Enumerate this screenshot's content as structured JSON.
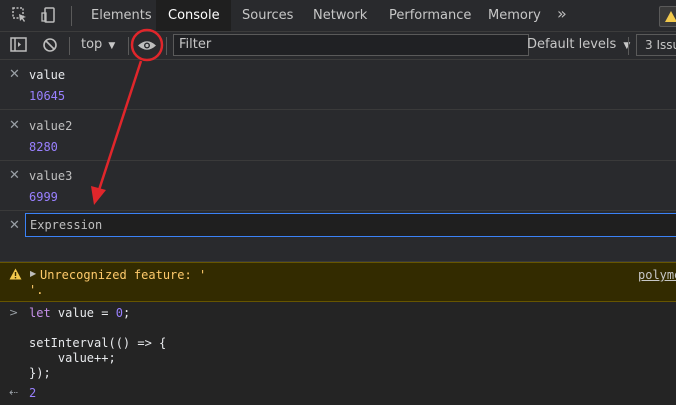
{
  "tabs": [
    {
      "label": "Elements"
    },
    {
      "label": "Console"
    },
    {
      "label": "Sources"
    },
    {
      "label": "Network"
    },
    {
      "label": "Performance"
    },
    {
      "label": "Memory"
    }
  ],
  "more_tabs": "»",
  "toolbar": {
    "context": "top",
    "filter_placeholder": "Filter",
    "levels": "Default levels",
    "issues": "3 Issu"
  },
  "live_expressions": [
    {
      "name": "value",
      "value": "10645"
    },
    {
      "name": "value2",
      "value": "8280"
    },
    {
      "name": "value3",
      "value": "6999"
    }
  ],
  "expression_placeholder": "Expression",
  "warning": {
    "line1": "Unrecognized feature: '",
    "line2": "'.",
    "source": "polyme"
  },
  "code": {
    "line1_kw": "let",
    "line1_rest": " value = ",
    "line1_num": "0",
    "line1_end": ";",
    "line2": "setInterval(() => {",
    "line3": "    value++;",
    "line4": "});",
    "result": "2"
  },
  "colors": {
    "accent": "#3b82f6",
    "annotation": "#e0262b",
    "warning_text": "#ffcb6b",
    "value_purple": "#9980ff"
  },
  "icons": [
    "inspect-icon",
    "device-toolbar-icon",
    "sidebar-toggle-icon",
    "clear-console-icon",
    "eye-icon",
    "warning-icon",
    "close-icon"
  ]
}
